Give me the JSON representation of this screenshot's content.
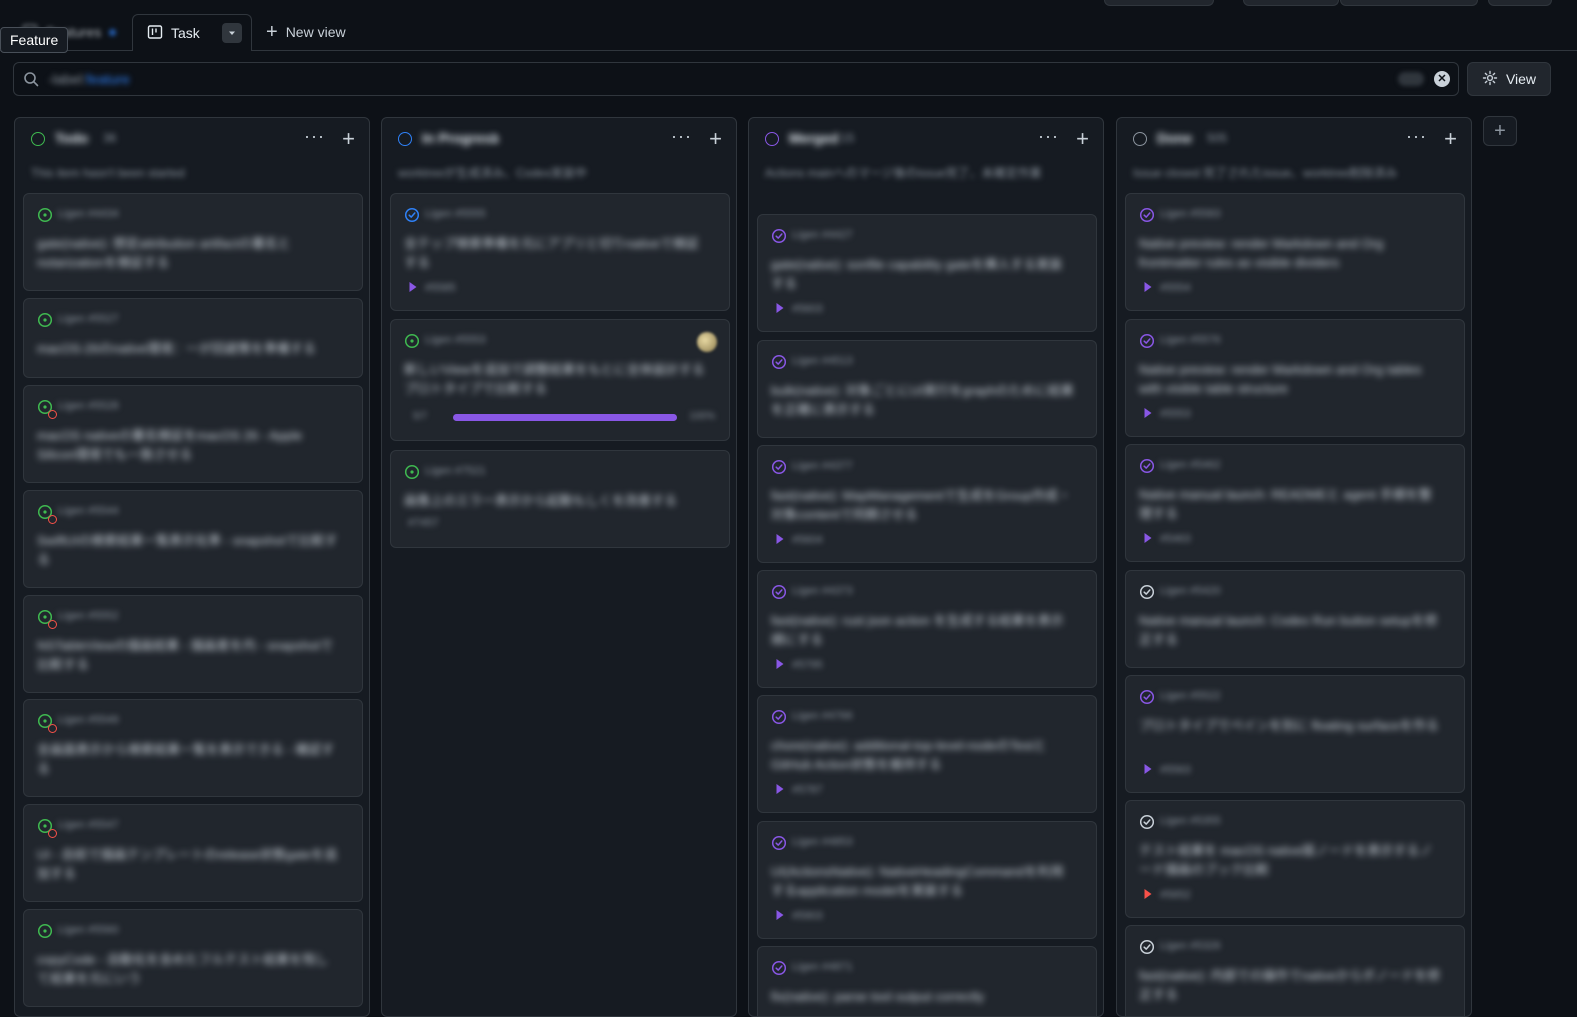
{
  "tooltip": "Feature",
  "tabs": {
    "hidden_label": "Features",
    "active": "Task",
    "new_view": "New view"
  },
  "filter": {
    "prefix": "-label:",
    "value": "feature",
    "count": "227"
  },
  "view_button": "View",
  "colors": {
    "todo": "#3fb950",
    "inprogress": "#2f81f7",
    "merged": "#8957e5",
    "done": "#8b949e"
  },
  "columns": [
    {
      "name": "Todo",
      "count": "36",
      "status": "todo",
      "description": "This item hasn't been started",
      "cards": [
        {
          "num": "Ligen #4434",
          "title": "gate(native): 想定attribution artifactの署名とnotarizationを検証する",
          "pr": "",
          "blocked": false
        },
        {
          "num": "Ligen #5527",
          "title": "macOS-26のnative環境：一が回避策を準備する",
          "pr": "",
          "blocked": false
        },
        {
          "num": "Ligen #5528",
          "title": "macOS nativeの署名検証をmacOS 26 - Apple Silicon環境でも一致させる",
          "pr": "",
          "blocked": true
        },
        {
          "num": "Ligen #5544",
          "title": "SwiftUIの検索結果一覧表示化準 - snapshotで比較する",
          "pr": "",
          "blocked": true
        },
        {
          "num": "Ligen #5552",
          "title": "NSTableViewの描画結果 - 描画差を内 - snapshotで比較する",
          "pr": "",
          "blocked": true
        },
        {
          "num": "Ligen #5549",
          "title": "全画面表示から検索結果一覧を表示できる - 確認する",
          "pr": "",
          "blocked": true
        },
        {
          "num": "Ligen #5547",
          "title": "UI - 自前で描画テンプレートのrelease状態gateを追加する",
          "pr": "",
          "blocked": true
        },
        {
          "num": "Ligen #5560",
          "title": "copyCode - 自動化を含めたフルテスト結果を残して結果を元にいう",
          "pr": "",
          "blocked": false
        }
      ]
    },
    {
      "name": "In Progress",
      "count": "3",
      "status": "inprogress",
      "description": "worktreeが生成済み、Codex実装中",
      "cards": [
        {
          "num": "Ligen #5555",
          "title": "全テップ検索準備を元にアプリと切りnativeで検証する",
          "pr": "#5585",
          "kind": "pr"
        },
        {
          "num": "Ligen #5553",
          "title": "新しいViewを追加で調整結果をもとに全体設計するプロトタイプで比較する",
          "progress_label": "5/7",
          "progress_pct": 100,
          "progress_text": "100%",
          "kind": "progress"
        },
        {
          "num": "Ligen #7521",
          "title": "画像上のエラー表示から起動もしくを改善する",
          "meta": "#7457",
          "kind": "meta"
        }
      ]
    },
    {
      "name": "Merged",
      "count": "15",
      "status": "merged",
      "description": "Actions mainへのマージ後のissue完了、未確定作業",
      "cards": [
        {
          "num": "Ligen #4427",
          "title": "gate(native): sonfile capability gateを挿入する実装する",
          "pr": "#5603"
        },
        {
          "num": "Ligen #4513",
          "title": "bulk(native): 対象ごとにUI実行をgraphのために結果を正確に表示する",
          "pr": ""
        },
        {
          "num": "Ligen #4377",
          "title": "fast(native): MapManagementで生成をGroup作成・対象contentで同期させる",
          "pr": "#5604"
        },
        {
          "num": "Ligen #4373",
          "title": "fast(native): rust json action を生成する結果を表示順にする",
          "pr": "#5795"
        },
        {
          "num": "Ligen #4766",
          "title": "chore(native): additional-top-level-nodeのTestとGitHub Action状態を維持する",
          "pr": "#5787"
        },
        {
          "num": "Ligen #4853",
          "title": "UI(ActionsNative): NativeHeadingCommandを利用するapplication modelを実装する",
          "pr": "#5903"
        },
        {
          "num": "Ligen #4871",
          "title": "fix(native): parse tool output correctly",
          "pr": ""
        }
      ]
    },
    {
      "name": "Done",
      "count": "505",
      "status": "done",
      "description": "Issue closed 完了されたissue、worktree削除済み",
      "cards": [
        {
          "num": "Ligen #5583",
          "title": "Native preview: render Markdown and Org frontmatter rules as visible dividers",
          "pr": "#5554",
          "open": true
        },
        {
          "num": "Ligen #5576",
          "title": "Native preview: render Markdown and Org tables with visible table structure",
          "pr": "#5553",
          "open": true
        },
        {
          "num": "Ligen #5462",
          "title": "Native manual launch: READMEと agent 手順を整理する",
          "pr": "#5463",
          "open": true
        },
        {
          "num": "Ligen #5420",
          "title": "Native manual launch: Codex Run button setupを修正する",
          "pr": "",
          "open": false
        },
        {
          "num": "Ligen #5522",
          "title": "プロトタイプでペインを別に floating surfaceを作る",
          "pr": "#5563",
          "open": true
        },
        {
          "num": "Ligen #5355",
          "title": "テスト結果を macOS native版ノードを表示するノード描画のブック比較",
          "pr": "#5652",
          "open": false,
          "pr_kind": "closed"
        },
        {
          "num": "Ligen #5326",
          "title": "fast(native): 内部での操作でnativeからボノードを修正する",
          "pr": "",
          "open": false
        }
      ]
    }
  ]
}
